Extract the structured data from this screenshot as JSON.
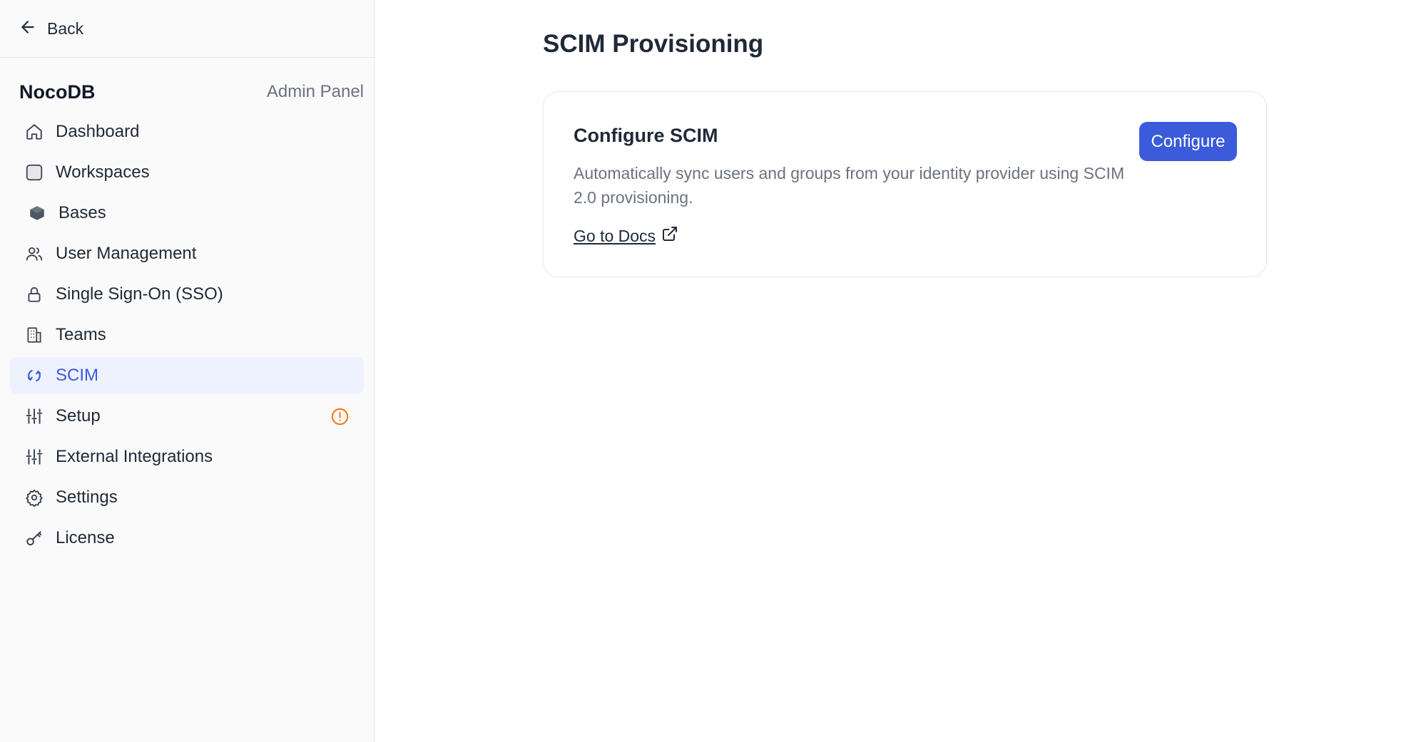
{
  "sidebar": {
    "back_label": "Back",
    "brand_name": "NocoDB",
    "brand_sub": "Admin Panel",
    "items": [
      {
        "label": "Dashboard",
        "icon": "home-icon"
      },
      {
        "label": "Workspaces",
        "icon": "workspace-icon"
      },
      {
        "label": "Bases",
        "icon": "base-icon"
      },
      {
        "label": "User Management",
        "icon": "users-icon"
      },
      {
        "label": "Single Sign-On (SSO)",
        "icon": "lock-icon"
      },
      {
        "label": "Teams",
        "icon": "building-icon"
      },
      {
        "label": "SCIM",
        "icon": "sync-icon",
        "active": true
      },
      {
        "label": "Setup",
        "icon": "sliders-icon",
        "badge": "warning-icon"
      },
      {
        "label": "External Integrations",
        "icon": "sliders-icon"
      },
      {
        "label": "Settings",
        "icon": "gear-icon"
      },
      {
        "label": "License",
        "icon": "key-icon"
      }
    ]
  },
  "main": {
    "title": "SCIM Provisioning",
    "card": {
      "title": "Configure SCIM",
      "description": "Automatically sync users and groups from your identity provider using SCIM 2.0 provisioning.",
      "docs_label": "Go to Docs",
      "configure_label": "Configure"
    }
  },
  "colors": {
    "accent": "#3b5bdb",
    "active_bg": "#eef2ff",
    "warning": "#f97316"
  }
}
